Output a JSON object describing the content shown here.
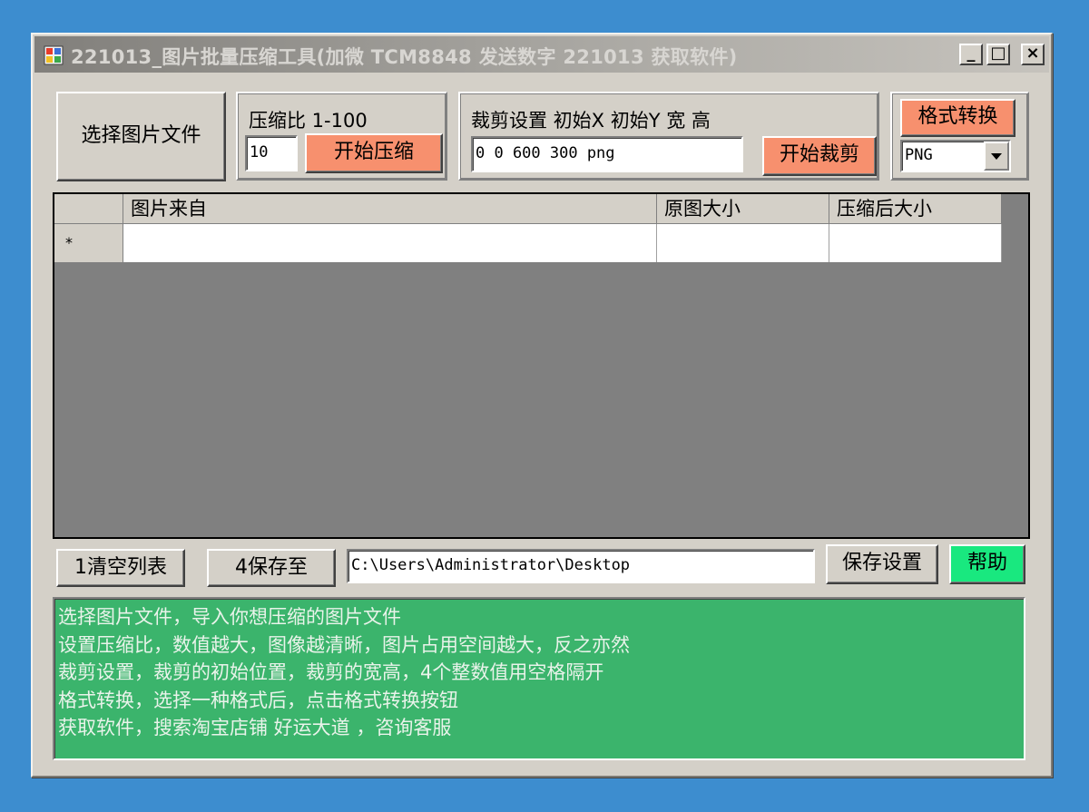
{
  "window": {
    "title": "221013_图片批量压缩工具(加微 TCM8848 发送数字 221013 获取软件)",
    "minimize": "_",
    "maximize": "□",
    "close": "×"
  },
  "toolbar": {
    "select_files_button": "选择图片文件",
    "compress": {
      "label": "压缩比 1-100",
      "ratio_value": "10",
      "start_button": "开始压缩"
    },
    "crop": {
      "label": "裁剪设置 初始X 初始Y 宽 高",
      "settings_value": "0 0 600 300 png",
      "start_button": "开始裁剪"
    },
    "format": {
      "convert_button": "格式转换",
      "selected": "PNG"
    }
  },
  "grid": {
    "columns": [
      "图片来自",
      "原图大小",
      "压缩后大小"
    ],
    "new_row_marker": "*"
  },
  "bottom": {
    "clear_button": "1清空列表",
    "save_to_button": "4保存至",
    "save_path": "C:\\Users\\Administrator\\Desktop",
    "save_settings_button": "保存设置",
    "help_button": "帮助"
  },
  "help_text": [
    "选择图片文件，导入你想压缩的图片文件",
    "设置压缩比，数值越大，图像越清晰，图片占用空间越大，反之亦然",
    "裁剪设置，裁剪的初始位置，裁剪的宽高，4个整数值用空格隔开",
    "格式转换，选择一种格式后，点击格式转换按钮",
    "获取软件，搜索淘宝店铺 好运大道 ，咨询客服"
  ],
  "colors": {
    "desktop": "#3d8dcf",
    "orange_button": "#f7906e",
    "help_button": "#19e87f",
    "log_background": "#3bb46c"
  }
}
